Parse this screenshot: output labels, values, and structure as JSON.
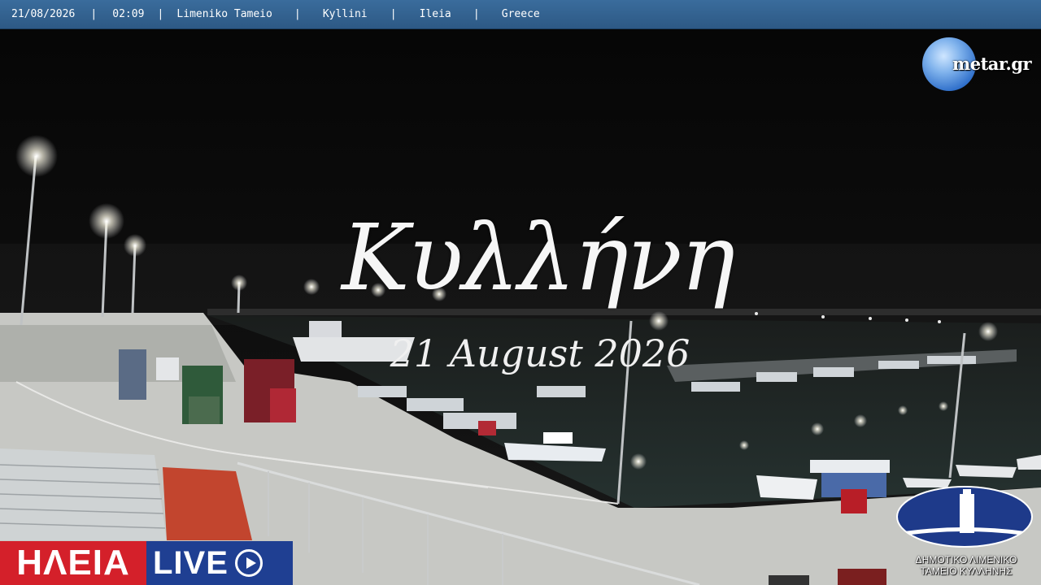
{
  "header": {
    "date": "21/08/2026",
    "time": "02:09",
    "location": "Limeniko Tameio",
    "town": "Kyllini",
    "region": "Ileia",
    "country": "Greece",
    "separator": "|"
  },
  "watermark": {
    "brand": "metar.gr"
  },
  "overlay": {
    "title": "Κυλλήνη",
    "subtitle": "21 August 2026"
  },
  "broadcaster": {
    "red_text": "ΗΛΕΙΑ",
    "blue_text": "LIVE",
    "play_icon": "play-circle-icon",
    "colors": {
      "red": "#d4202a",
      "blue": "#1f3f92"
    }
  },
  "port_authority": {
    "line1": "ΔΗΜΟΤΙΚΟ ΛΙΜΕΝΙΚΟ",
    "line2": "ΤΑΜΕΙΟ ΚΥΛΛΗΝΗΣ"
  }
}
